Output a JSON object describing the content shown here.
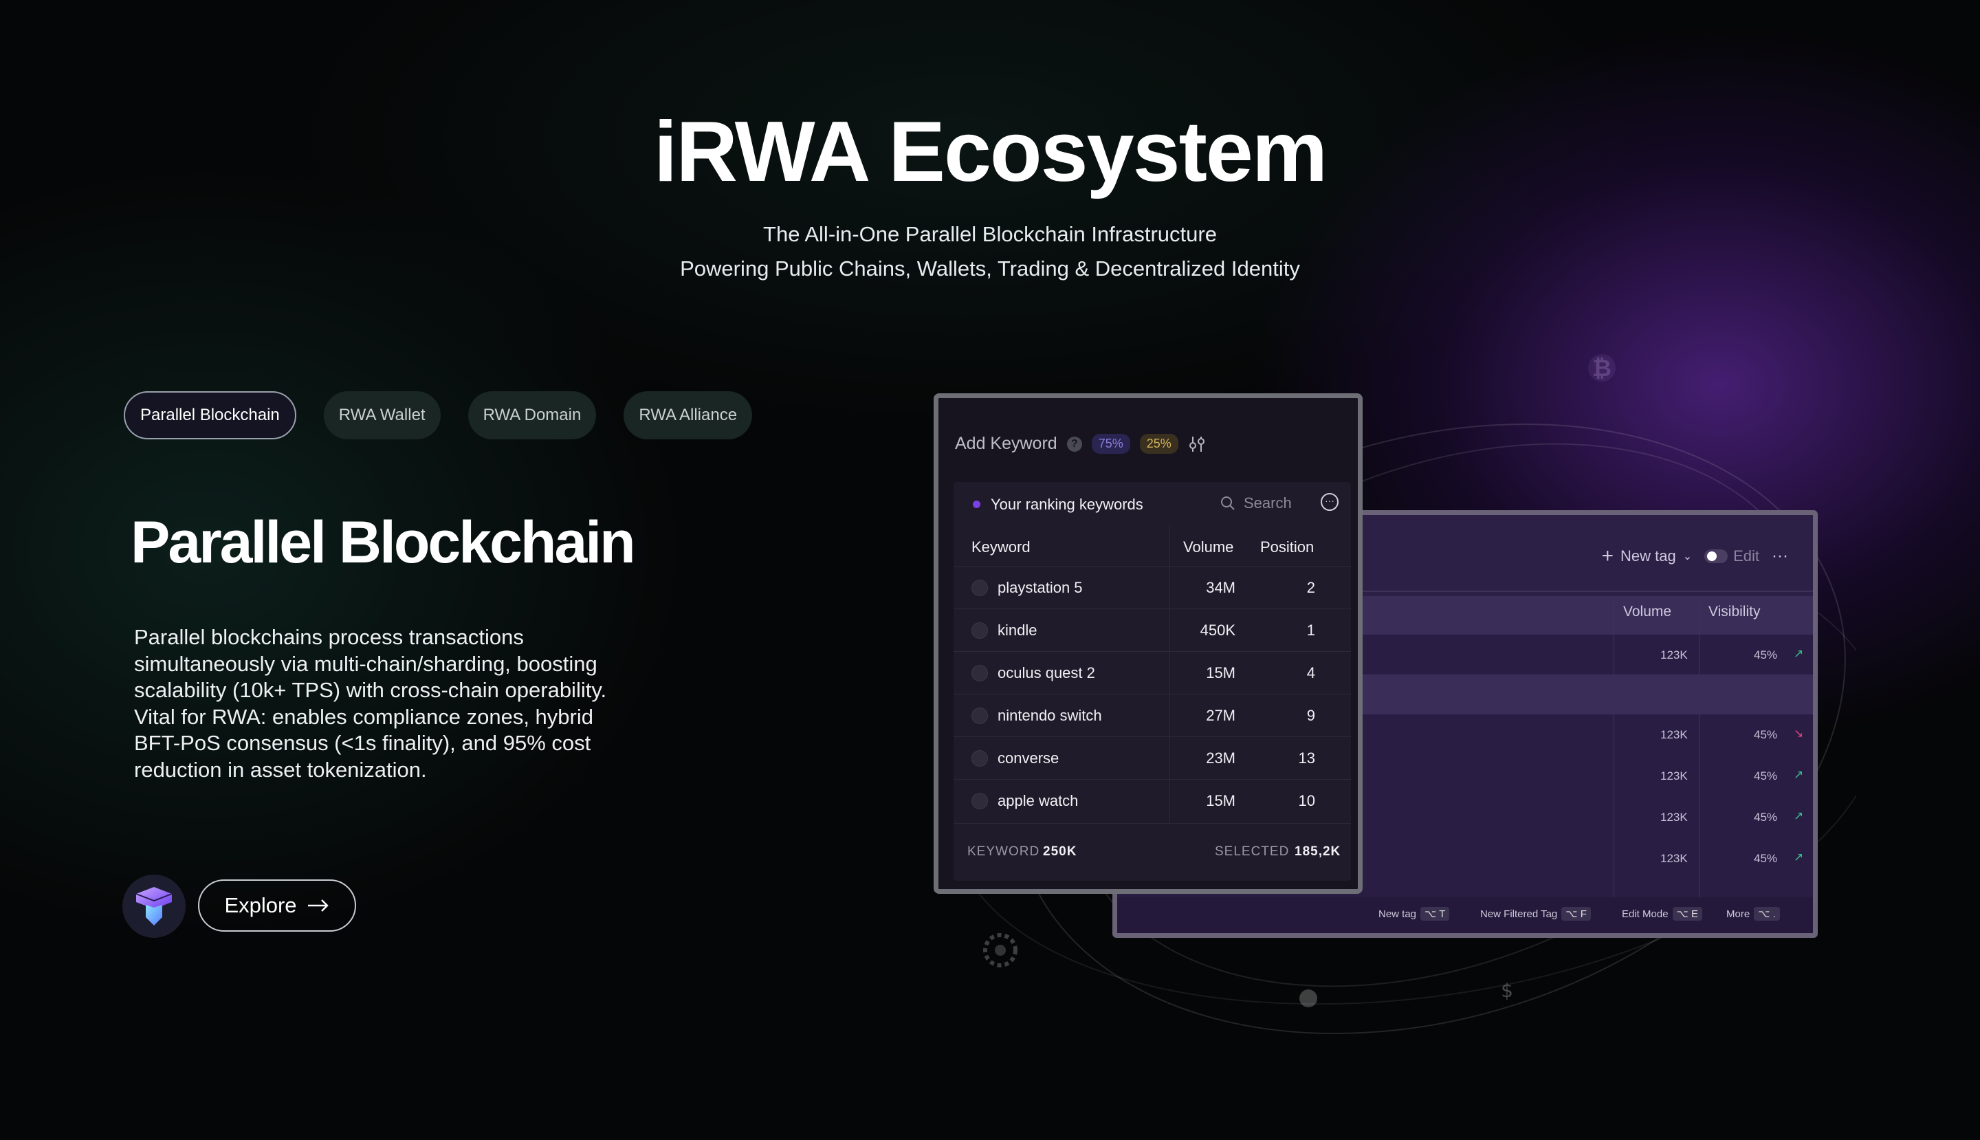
{
  "hero": {
    "title": "iRWA Ecosystem",
    "subtitle_line1": "The All-in-One Parallel Blockchain Infrastructure",
    "subtitle_line2": "Powering Public Chains, Wallets, Trading & Decentralized Identity"
  },
  "tabs": [
    {
      "label": "Parallel Blockchain",
      "active": true
    },
    {
      "label": "RWA Wallet",
      "active": false
    },
    {
      "label": "RWA Domain",
      "active": false
    },
    {
      "label": "RWA Alliance",
      "active": false
    }
  ],
  "section": {
    "heading": "Parallel Blockchain",
    "description": "Parallel blockchains process transactions\nsimultaneously via multi-chain/sharding, boosting\nscalability (10k+ TPS) with cross-chain operability.\nVital for RWA: enables compliance zones, hybrid\nBFT-PoS consensus (<1s finality), and 95% cost\nreduction in asset tokenization.",
    "explore_label": "Explore"
  },
  "front_card": {
    "title": "Add Keyword",
    "pill_a": "75%",
    "pill_b": "25%",
    "list_title": "Your ranking keywords",
    "search_label": "Search",
    "columns": [
      "Keyword",
      "Volume",
      "Position"
    ],
    "rows": [
      {
        "keyword": "playstation 5",
        "volume": "34M",
        "position": "2"
      },
      {
        "keyword": "kindle",
        "volume": "450K",
        "position": "1"
      },
      {
        "keyword": "oculus quest 2",
        "volume": "15M",
        "position": "4"
      },
      {
        "keyword": "nintendo switch",
        "volume": "27M",
        "position": "9"
      },
      {
        "keyword": "converse",
        "volume": "23M",
        "position": "13"
      },
      {
        "keyword": "apple watch",
        "volume": "15M",
        "position": "10"
      }
    ],
    "footer_keyword_label": "KEYWORD",
    "footer_keyword_value": "250K",
    "footer_selected_label": "SELECTED",
    "footer_selected_value": "185,2K"
  },
  "back_card": {
    "new_tag_label": "New tag",
    "edit_label": "Edit",
    "columns": [
      "Volume",
      "Visibility"
    ],
    "rows": [
      {
        "volume": "123K",
        "visibility": "45%"
      },
      {
        "volume": "123K",
        "visibility": "45%"
      },
      {
        "volume": "123K",
        "visibility": "45%"
      },
      {
        "volume": "123K",
        "visibility": "45%"
      },
      {
        "volume": "123K",
        "visibility": "45%"
      }
    ],
    "shortcuts": [
      {
        "label": "New tag",
        "key": "⌥ T"
      },
      {
        "label": "New Filtered Tag",
        "key": "⌥ F"
      },
      {
        "label": "Edit Mode",
        "key": "⌥ E"
      },
      {
        "label": "More",
        "key": "⌥ ."
      }
    ]
  },
  "colors": {
    "accent_purple": "#7b3fe4",
    "background": "#050607"
  }
}
